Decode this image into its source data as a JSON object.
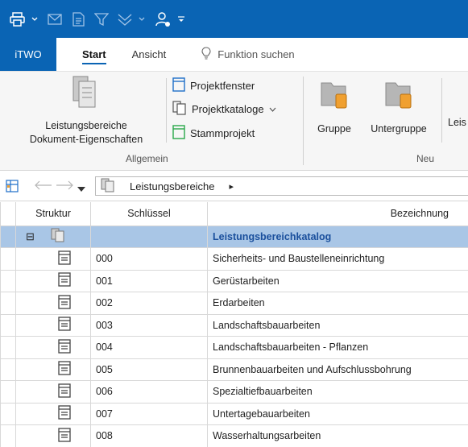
{
  "quick_access": {
    "icons": [
      "print-icon",
      "mail-icon",
      "document-icon",
      "filter-icon",
      "double-chevron-icon",
      "user-icon",
      "customize-icon"
    ]
  },
  "tabs": {
    "file": "iTWO",
    "start": "Start",
    "view": "Ansicht",
    "search": "Funktion suchen"
  },
  "ribbon": {
    "allgemein": {
      "label": "Allgemein",
      "big_button_line1": "Leistungsbereiche",
      "big_button_line2": "Dokument-Eigenschaften",
      "projektfenster": "Projektfenster",
      "projektkataloge": "Projektkataloge",
      "stammprojekt": "Stammprojekt"
    },
    "neu": {
      "label": "Neu",
      "gruppe": "Gruppe",
      "untergruppe": "Untergruppe",
      "truncated": "Leis"
    },
    "colors": {
      "folder": "#b6b6b6",
      "folder_accent": "#f0a030",
      "blue_icon": "#1f6fc9",
      "green_icon": "#2aa84a"
    }
  },
  "navbar": {
    "breadcrumb": "Leistungsbereiche",
    "arrow": "▸"
  },
  "grid": {
    "headers": {
      "structure": "Struktur",
      "key": "Schlüssel",
      "description": "Bezeichnung"
    },
    "root": {
      "collapse": "⊟",
      "description": "Leistungsbereichkatalog"
    },
    "rows": [
      {
        "key": "000",
        "description": "Sicherheits- und Baustelleneinrichtung"
      },
      {
        "key": "001",
        "description": "Gerüstarbeiten"
      },
      {
        "key": "002",
        "description": "Erdarbeiten"
      },
      {
        "key": "003",
        "description": "Landschaftsbauarbeiten"
      },
      {
        "key": "004",
        "description": "Landschaftsbauarbeiten - Pflanzen"
      },
      {
        "key": "005",
        "description": "Brunnenbauarbeiten und Aufschlussbohrung"
      },
      {
        "key": "006",
        "description": "Spezialtiefbauarbeiten"
      },
      {
        "key": "007",
        "description": "Untertagebauarbeiten"
      },
      {
        "key": "008",
        "description": "Wasserhaltungsarbeiten"
      }
    ],
    "colors": {
      "selected_row": "#a9c6e6",
      "selected_text": "#1a4f9c"
    }
  }
}
